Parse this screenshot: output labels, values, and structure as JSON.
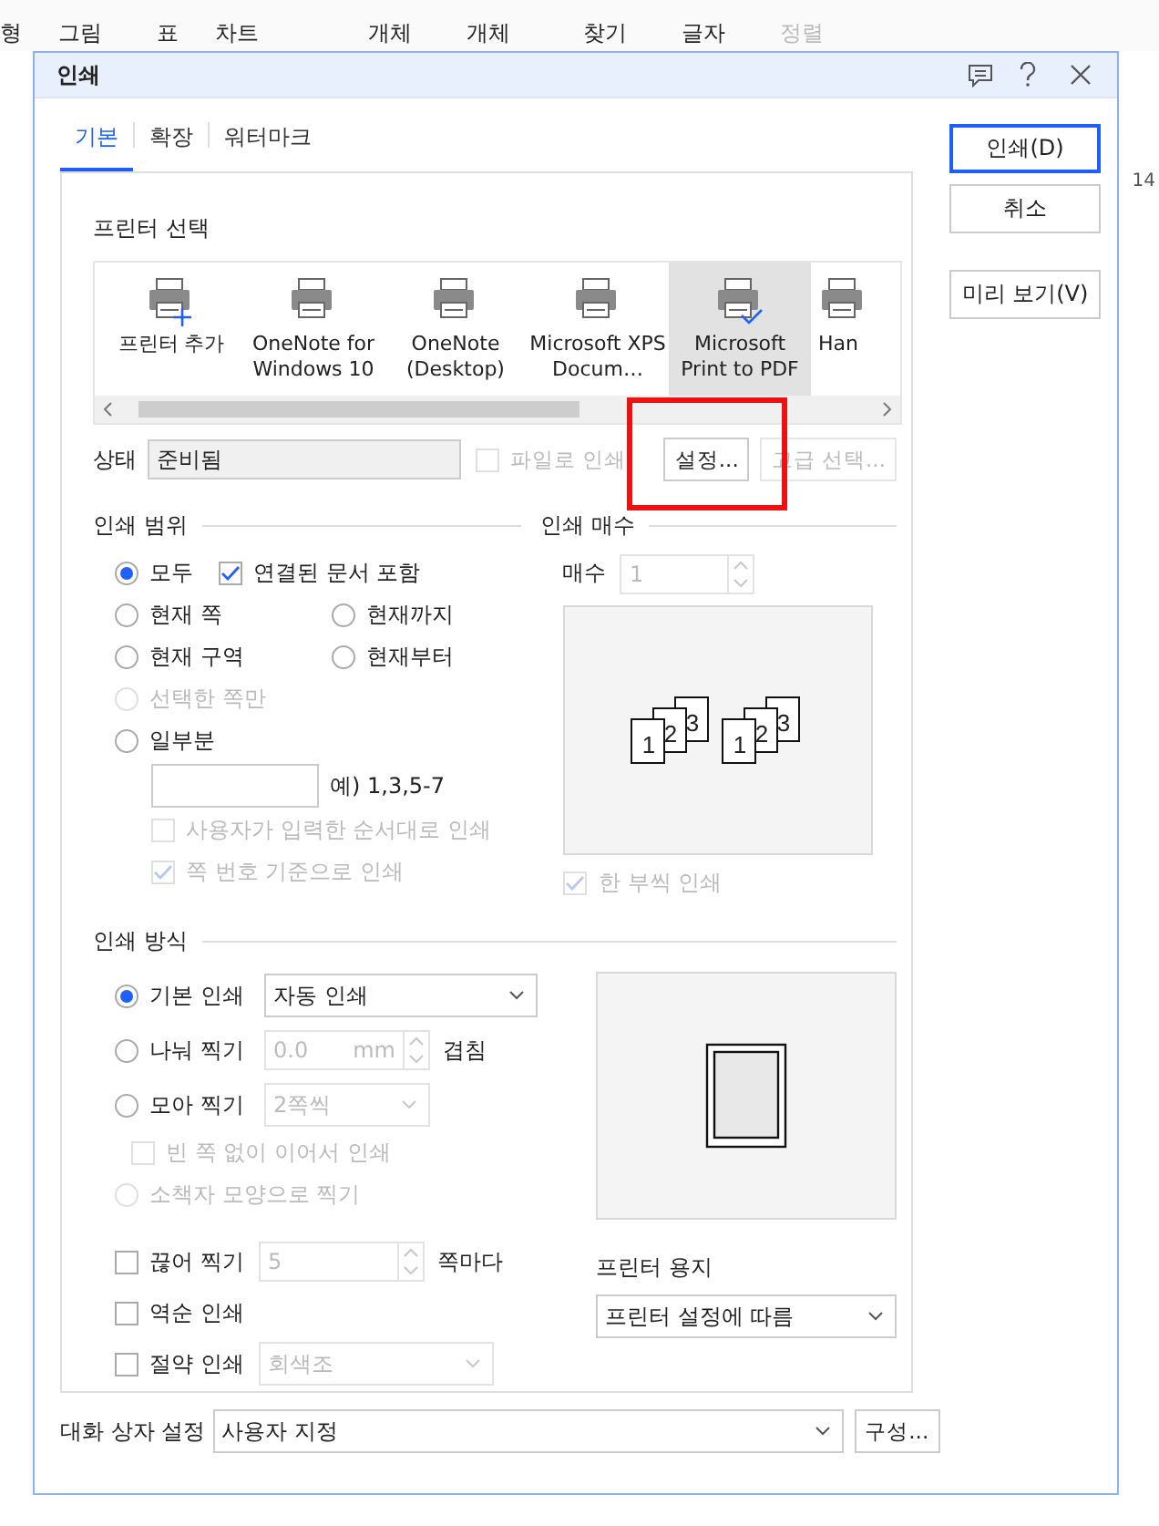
{
  "app_toolbar": [
    {
      "label": "형",
      "disabled": false
    },
    {
      "label": "그림",
      "disabled": false
    },
    {
      "label": "표",
      "disabled": false
    },
    {
      "label": "차트",
      "disabled": false
    },
    {
      "label": "개체",
      "disabled": false
    },
    {
      "label": "개체",
      "disabled": false
    },
    {
      "label": "찾기",
      "disabled": false
    },
    {
      "label": "글자",
      "disabled": false
    },
    {
      "label": "정렬",
      "disabled": true
    }
  ],
  "ruler_label": "14",
  "dialog": {
    "title": "인쇄"
  },
  "tabs": [
    {
      "label": "기본",
      "selected": true
    },
    {
      "label": "확장",
      "selected": false
    },
    {
      "label": "워터마크",
      "selected": false
    }
  ],
  "printer_select": {
    "label": "프린터 선택",
    "printers": [
      {
        "name": "프린터 추가",
        "kind": "add",
        "selected": false
      },
      {
        "name": "OneNote for Windows 10",
        "kind": "printer",
        "selected": false
      },
      {
        "name": "OneNote (Desktop)",
        "kind": "printer",
        "selected": false
      },
      {
        "name": "Microsoft XPS Docum…",
        "kind": "printer",
        "selected": false
      },
      {
        "name": "Microsoft Print to PDF",
        "kind": "printer",
        "selected": true
      },
      {
        "name": "Han",
        "kind": "printer",
        "selected": false
      }
    ]
  },
  "status": {
    "label": "상태",
    "value": "준비됨"
  },
  "print_to_file": {
    "label": "파일로 인쇄",
    "checked": false,
    "disabled": true
  },
  "settings_button": {
    "label": "설정...",
    "disabled": false,
    "highlighted": true
  },
  "advanced_button": {
    "label": "고급 선택...",
    "disabled": true
  },
  "print_range": {
    "title": "인쇄 범위",
    "options": [
      {
        "label": "모두",
        "selected": true,
        "disabled": false
      },
      {
        "label": "현재 쪽",
        "selected": false,
        "disabled": false
      },
      {
        "label": "현재까지",
        "selected": false,
        "disabled": false
      },
      {
        "label": "현재 구역",
        "selected": false,
        "disabled": false
      },
      {
        "label": "현재부터",
        "selected": false,
        "disabled": false
      },
      {
        "label": "선택한 쪽만",
        "selected": false,
        "disabled": true
      },
      {
        "label": "일부분",
        "selected": false,
        "disabled": false
      }
    ],
    "include_linked": {
      "label": "연결된 문서 포함",
      "checked": true,
      "disabled": false
    },
    "pages_hint": "예) 1,3,5-7",
    "user_order": {
      "label": "사용자가 입력한 순서대로 인쇄",
      "checked": false,
      "disabled": true
    },
    "page_number_order": {
      "label": "쪽 번호 기준으로 인쇄",
      "checked": true,
      "disabled": true
    }
  },
  "copies": {
    "title": "인쇄 매수",
    "label": "매수",
    "value": "1",
    "disabled": true,
    "preview_stacks": [
      {
        "pages": [
          "1",
          "2",
          "3"
        ]
      },
      {
        "pages": [
          "1",
          "2",
          "3"
        ]
      }
    ],
    "collate": {
      "label": "한 부씩 인쇄",
      "checked": true,
      "disabled": true
    }
  },
  "print_method": {
    "title": "인쇄 방식",
    "basic": {
      "label": "기본 인쇄",
      "selected": true,
      "disabled": false,
      "dropdown": "자동 인쇄"
    },
    "split": {
      "label": "나눠 찍기",
      "selected": false,
      "disabled": false,
      "value": "0.0",
      "unit": "mm",
      "suffix": "겹침"
    },
    "gather": {
      "label": "모아 찍기",
      "selected": false,
      "disabled": false,
      "dropdown": "2쪽씩"
    },
    "no_blank": {
      "label": "빈 쪽 없이 이어서 인쇄",
      "checked": false,
      "disabled": true
    },
    "booklet": {
      "label": "소책자 모양으로 찍기",
      "selected": false,
      "disabled": true
    },
    "break": {
      "label": "끊어 찍기",
      "checked": false,
      "disabled": false,
      "value": "5",
      "suffix": "쪽마다"
    },
    "reverse": {
      "label": "역순 인쇄",
      "checked": false,
      "disabled": false
    },
    "saving": {
      "label": "절약 인쇄",
      "checked": false,
      "disabled": false,
      "dropdown": "회색조"
    }
  },
  "paper": {
    "label": "프린터 용지",
    "value": "프린터 설정에 따름"
  },
  "buttons": [
    {
      "label": "인쇄(D)",
      "default": true
    },
    {
      "label": "취소",
      "default": false
    },
    {
      "label": "미리 보기(V)",
      "default": false
    }
  ],
  "dialog_settings": {
    "label": "대화 상자 설정",
    "value": "사용자 지정",
    "button": "구성..."
  }
}
